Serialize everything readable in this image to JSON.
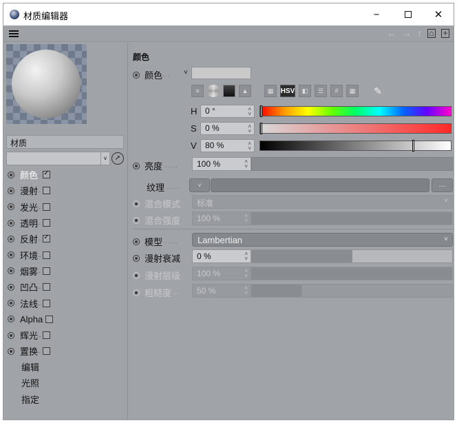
{
  "window": {
    "title": "材质编辑器",
    "minimize": "−",
    "close": "✕"
  },
  "menubar": {
    "back": "←",
    "forward": "→",
    "up": "↑",
    "lock": "🔒",
    "new_window": "+"
  },
  "left_panel": {
    "material_name": "材质",
    "channels": [
      {
        "label": "颜色",
        "checked": true,
        "active": true
      },
      {
        "label": "漫射",
        "checked": false
      },
      {
        "label": "发光",
        "checked": false
      },
      {
        "label": "透明",
        "checked": false
      },
      {
        "label": "反射",
        "checked": true
      },
      {
        "label": "环境",
        "checked": false
      },
      {
        "label": "烟雾",
        "checked": false
      },
      {
        "label": "凹凸",
        "checked": false
      },
      {
        "label": "法线",
        "checked": false
      },
      {
        "label": "Alpha",
        "checked": false
      },
      {
        "label": "辉光",
        "checked": false
      },
      {
        "label": "置换",
        "checked": false
      }
    ],
    "extra_items": [
      "编辑",
      "光照",
      "指定"
    ]
  },
  "color_section": {
    "title": "颜色",
    "color_label": "颜色",
    "color_dots": "...",
    "color_mode_arrow": "˅",
    "hsv_label": "HSV",
    "h_label": "H",
    "h_value": "0 °",
    "s_label": "S",
    "s_value": "0 %",
    "v_label": "V",
    "v_value": "80 %",
    "h_fraction": 0.0,
    "s_fraction": 0.0,
    "v_fraction": 0.8,
    "brightness_label": "亮度",
    "brightness_value": "100 %",
    "texture_label": "纹理",
    "texture_more": "...",
    "blend_mode_label": "混合模式",
    "blend_mode_value": "标准",
    "blend_strength_label": "混合强度",
    "blend_strength_value": "100 %",
    "model_label": "模型",
    "model_value": "Lambertian",
    "diffuse_falloff_label": "漫射衰减",
    "diffuse_falloff_value": "0 %",
    "diffuse_falloff_fraction": 0.5,
    "diffuse_level_label": "漫射层级",
    "diffuse_level_value": "100 %",
    "roughness_label": "粗糙度",
    "roughness_value": "50 %"
  }
}
